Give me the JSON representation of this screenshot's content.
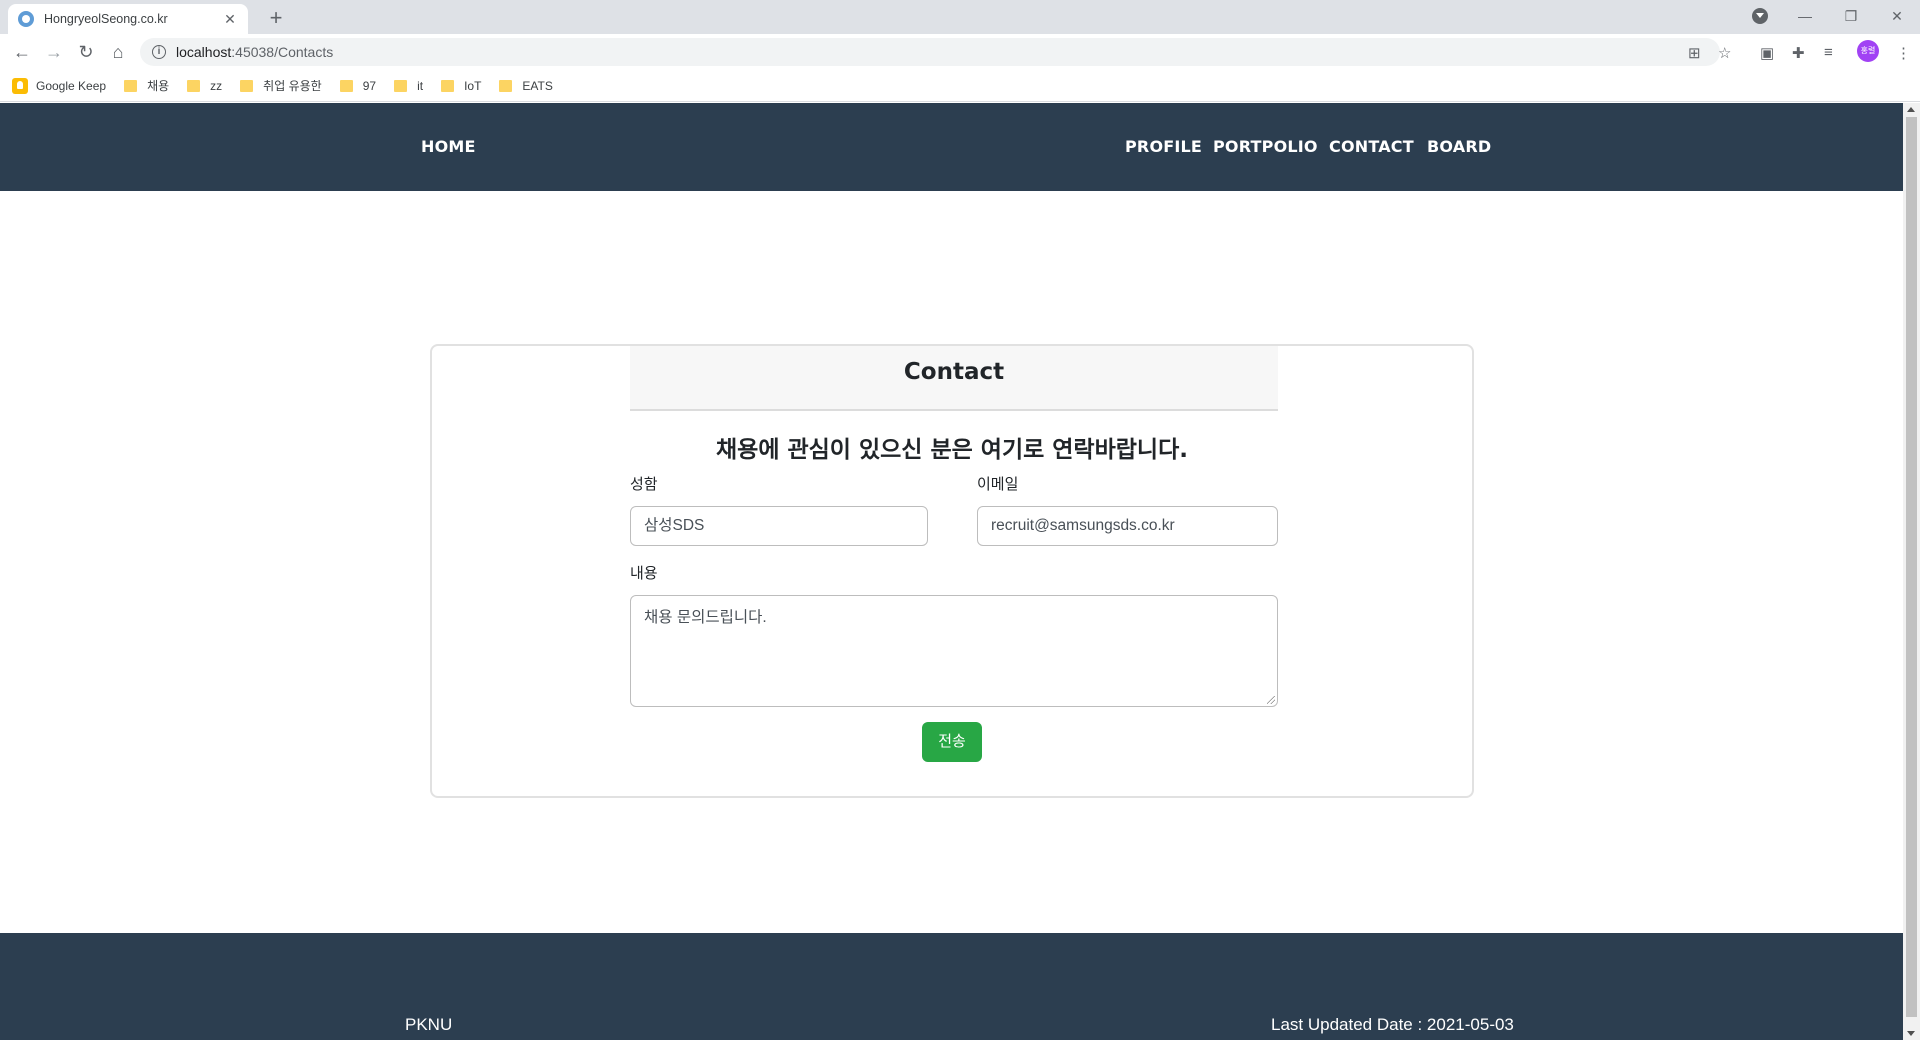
{
  "browser": {
    "tab_title": "HongryeolSeong.co.kr",
    "tab_close": "✕",
    "new_tab": "+",
    "url_host": "localhost",
    "url_rest": ":45038/Contacts",
    "avatar_text": "홍렬",
    "bookmarks": [
      "Google Keep",
      "채용",
      "zz",
      "취업 유용한",
      "97",
      "it",
      "IoT",
      "EATS"
    ]
  },
  "nav": {
    "home": "HOME",
    "profile": "PROFILE",
    "portfolio": "PORTPOLIO",
    "contact": "CONTACT",
    "board": "BOARD"
  },
  "contact": {
    "title": "Contact",
    "subtitle": "채용에 관심이 있으신 분은 여기로 연락바랍니다.",
    "name_label": "성함",
    "name_value": "삼성SDS",
    "email_label": "이메일",
    "email_value": "recruit@samsungsds.co.kr",
    "content_label": "내용",
    "content_value": "채용 문의드립니다.",
    "submit_label": "전송"
  },
  "footer": {
    "left": "PKNU",
    "right": "Last Updated Date : 2021-05-03"
  },
  "colors": {
    "nav_bg": "#2c3e50",
    "submit_bg": "#28a745"
  }
}
